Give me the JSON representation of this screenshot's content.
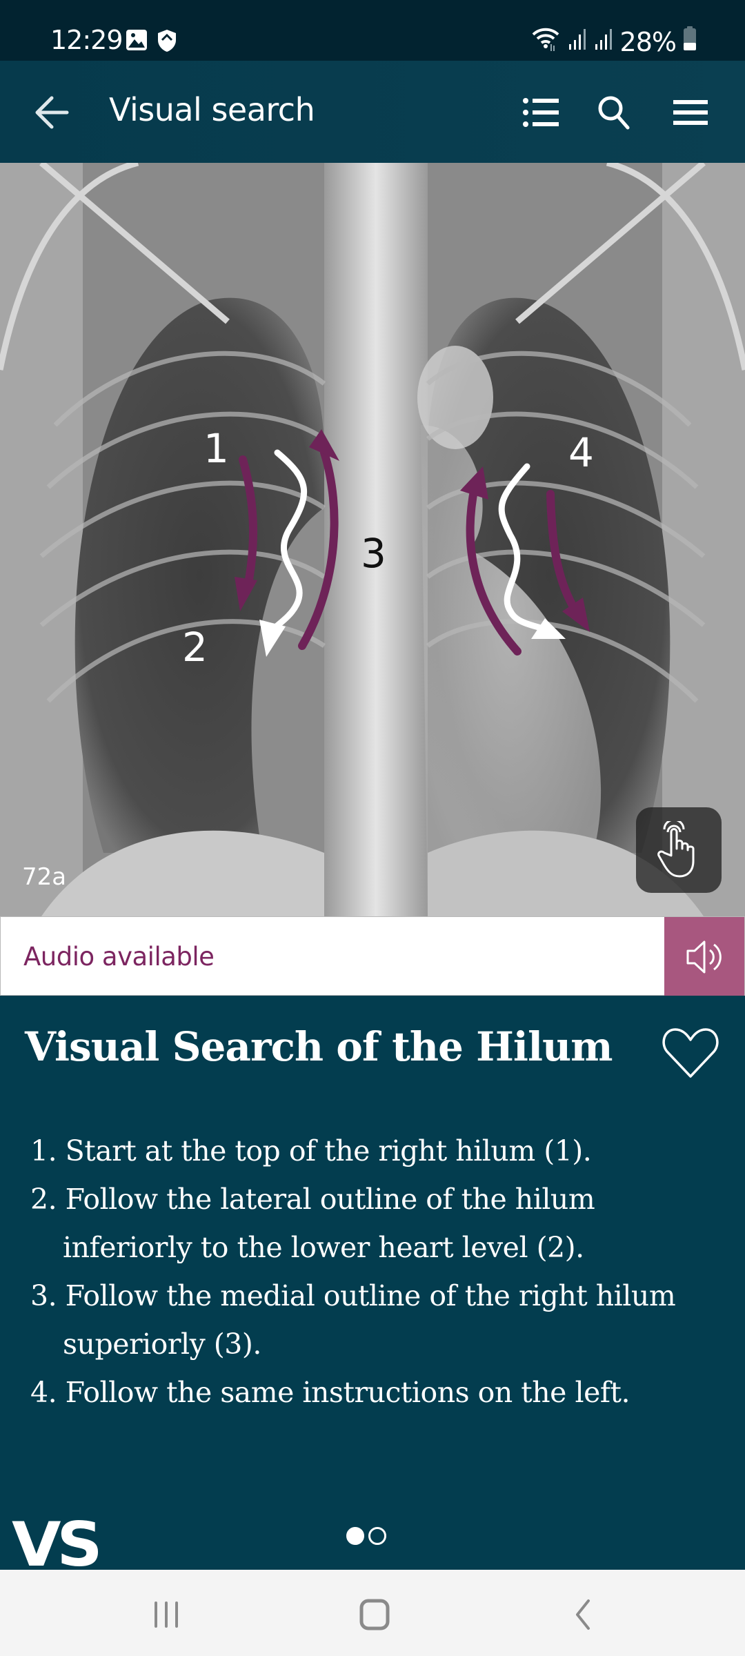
{
  "status_bar": {
    "time": "12:29",
    "battery": "28%",
    "icons_left": [
      "gallery-icon",
      "shield-icon"
    ],
    "icons_right": [
      "wifi-icon",
      "signal-icon",
      "signal-icon",
      "battery-icon"
    ]
  },
  "app_bar": {
    "title": "Visual search",
    "back_icon": "arrow-left-icon",
    "actions": [
      "list-icon",
      "search-icon",
      "menu-icon"
    ]
  },
  "figure": {
    "label": "72a",
    "annotations": [
      "1",
      "2",
      "3",
      "4"
    ],
    "arrow_colors": {
      "purple": "#6e2358",
      "white": "#ffffff"
    },
    "interactive_icon": "touch-hand-icon"
  },
  "audio": {
    "label": "Audio available",
    "icon": "speaker-icon",
    "label_color": "#7c2560",
    "button_color": "#a8577f"
  },
  "content": {
    "title": "Visual Search of the Hilum",
    "favorite_icon": "heart-icon",
    "steps": [
      "1. Start at the top of the right hilum (1).",
      "2. Follow the lateral outline of the hilum inferiorly to the lower heart level (2).",
      "3. Follow the medial outline of the right hilum superiorly (3).",
      "4. Follow the same instructions on the left."
    ],
    "logo": "VS",
    "pager": {
      "total": 2,
      "current": 1
    }
  },
  "nav_bar": {
    "buttons": [
      "recents-icon",
      "home-icon",
      "back-icon"
    ]
  },
  "theme": {
    "primary": "#033d4f",
    "status_bar": "#022330"
  }
}
